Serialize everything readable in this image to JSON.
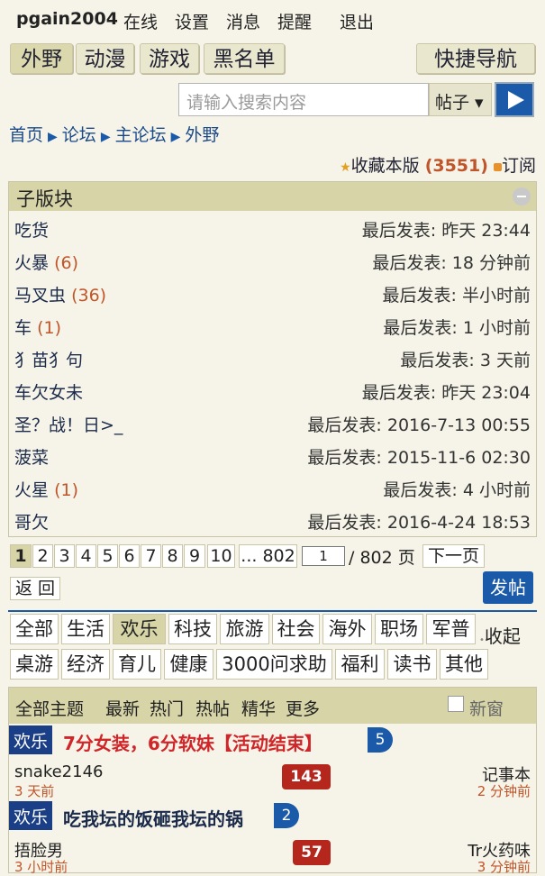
{
  "topnav": {
    "user": "pgain2004",
    "online": "在线",
    "settings": "设置",
    "messages": "消息",
    "reminders": "提醒",
    "logout": "退出"
  },
  "board_tabs": [
    "外野",
    "动漫",
    "游戏",
    "黑名单"
  ],
  "quick_nav": "快捷导航",
  "search": {
    "placeholder": "请输入搜索内容",
    "type": "帖子 ▾"
  },
  "breadcrumb": [
    "首页",
    "论坛",
    "主论坛",
    "外野"
  ],
  "favorite": {
    "label": "收藏本版",
    "count": "(3551)",
    "subscribe": "订阅"
  },
  "subforums": {
    "title": "子版块",
    "items": [
      {
        "name": "吃货",
        "count": "",
        "last": "最后发表: 昨天 23:44"
      },
      {
        "name": "火暴",
        "count": "(6)",
        "last": "最后发表: 18 分钟前"
      },
      {
        "name": "马叉虫",
        "count": "(36)",
        "last": "最后发表: 半小时前"
      },
      {
        "name": "车",
        "count": "(1)",
        "last": "最后发表: 1 小时前"
      },
      {
        "name": "犭苗犭句",
        "count": "",
        "last": "最后发表: 3 天前"
      },
      {
        "name": "车欠女未",
        "count": "",
        "last": "最后发表: 昨天 23:04"
      },
      {
        "name": "圣？战！日>_",
        "count": "",
        "last": "最后发表: 2016-7-13 00:55"
      },
      {
        "name": "菠菜",
        "count": "",
        "last": "最后发表: 2015-11-6 02:30"
      },
      {
        "name": "火星",
        "count": "(1)",
        "last": "最后发表: 4 小时前"
      },
      {
        "name": "哥欠",
        "count": "",
        "last": "最后发表: 2016-4-24 18:53"
      }
    ]
  },
  "pagination": {
    "pages": [
      "1",
      "2",
      "3",
      "4",
      "5",
      "6",
      "7",
      "8",
      "9",
      "10"
    ],
    "last": "... 802",
    "current": "1",
    "total": "/ 802 页",
    "next": "下一页",
    "back": "返 回",
    "post": "发帖"
  },
  "categories_row1": [
    "全部",
    "生活",
    "欢乐",
    "科技",
    "旅游",
    "社会",
    "海外",
    "职场",
    "军普"
  ],
  "collapse_label": "收起",
  "categories_row2": [
    "桌游",
    "经济",
    "育儿",
    "健康",
    "3000问求助",
    "福利",
    "读书",
    "其他"
  ],
  "topic_header": {
    "all": "全部主题",
    "latest": "最新",
    "hot": "热门",
    "hotpost": "热帖",
    "digest": "精华",
    "more": "更多",
    "new_window": "新窗"
  },
  "topics": [
    {
      "tag": "欢乐",
      "title": "7分女装，6分软妹【活动结束】",
      "replies": "5",
      "author": "snake2146",
      "time": "3 天前",
      "views": "143",
      "last_by": "记事本",
      "last_time": "2 分钟前",
      "title_color": "#d0262a"
    },
    {
      "tag": "欢乐",
      "title": "吃我坛的饭砸我坛的锅",
      "replies": "2",
      "author": "捂脸男",
      "time": "3 小时前",
      "views": "57",
      "last_by": "Tr火药味",
      "last_time": "3 分钟前",
      "title_color": "#1a2a4a"
    }
  ]
}
